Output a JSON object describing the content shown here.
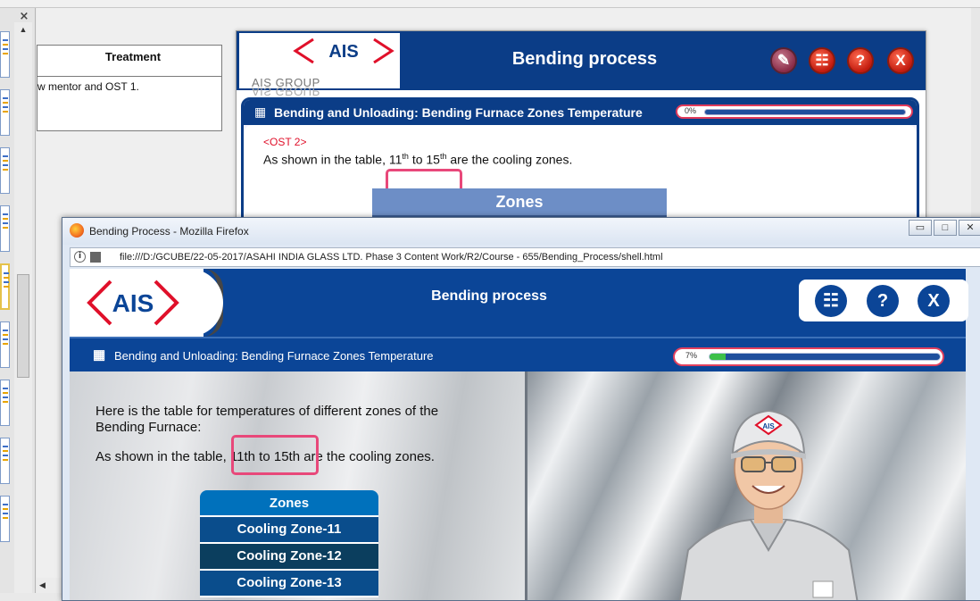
{
  "background_doc": {
    "close_glyph": "×",
    "table_header": "Treatment",
    "table_cell": "w mentor and OST 1."
  },
  "preview": {
    "logo_text": "AIS",
    "logo_group": "AIS GROUP",
    "title": "Bending process",
    "subtitle": "Bending and Unloading: Bending Furnace Zones Temperature",
    "progress_label": "0%",
    "ost_tag": "<OST 2>",
    "line_prefix": "As shown in the table, ",
    "line_n1": "11",
    "line_sup1": "th",
    "line_mid": " to 15",
    "line_sup2": "th",
    "line_suffix": " are the cooling zones.",
    "zones_header": "Zones",
    "buttons": [
      "✎",
      "☷",
      "?",
      "X"
    ]
  },
  "browser": {
    "window_title": "Bending Process - Mozilla Firefox",
    "url": "file:///D:/GCUBE/22-05-2017/ASAHI INDIA GLASS LTD. Phase 3 Content Work/R2/Course - 655/Bending_Process/shell.html",
    "min_glyph": "▭",
    "max_glyph": "□",
    "close_glyph": "✕"
  },
  "course": {
    "logo_text": "AIS",
    "title": "Bending process",
    "btn_menu": "☷",
    "btn_help": "?",
    "btn_close": "X",
    "subtitle": "Bending and Unloading: Bending Furnace Zones Temperature",
    "progress_label": "7%",
    "progress_fraction": 0.07,
    "intro": "Here is the table for temperatures of different zones of the Bending Furnace:",
    "cooling_line": "As shown in the table, 11th to 15th are the cooling zones.",
    "zones": {
      "header": "Zones",
      "rows": [
        "Cooling Zone-11",
        "Cooling Zone-12",
        "Cooling Zone-13"
      ]
    },
    "character_cap_text": "AIS"
  },
  "colors": {
    "brand_blue": "#0b4597",
    "brand_red": "#e0102a",
    "highlight_pink": "#e8487a",
    "progress_green": "#3cc04a"
  }
}
